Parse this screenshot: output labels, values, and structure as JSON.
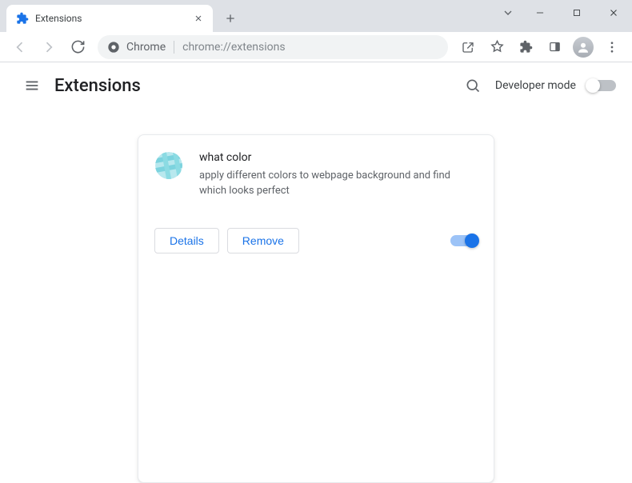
{
  "tab": {
    "title": "Extensions"
  },
  "omnibox": {
    "label": "Chrome",
    "url": "chrome://extensions"
  },
  "header": {
    "title": "Extensions",
    "developer_mode_label": "Developer mode",
    "developer_mode_enabled": false
  },
  "extension": {
    "name": "what color",
    "description": "apply different colors to webpage background and find which looks perfect",
    "details_label": "Details",
    "remove_label": "Remove",
    "enabled": true
  }
}
